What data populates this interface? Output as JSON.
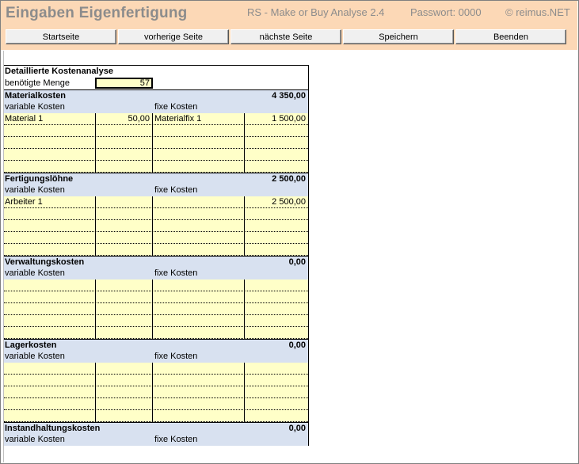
{
  "header": {
    "title": "Eingaben Eigenfertigung",
    "app_name": "RS - Make or Buy Analyse 2.4",
    "password": "Passwort: 0000",
    "copyright": "© reimus.NET"
  },
  "nav": {
    "start": "Startseite",
    "prev": "vorherige Seite",
    "next": "nächste Seite",
    "save": "Speichern",
    "quit": "Beenden"
  },
  "sheet": {
    "title": "Detaillierte Kostenanalyse",
    "qty_label": "benötigte Menge",
    "qty_value": "57",
    "var_label": "variable Kosten",
    "fix_label": "fixe Kosten",
    "sections": [
      {
        "name": "Materialkosten",
        "total": "4 350,00",
        "rows": [
          {
            "var_name": "Material 1",
            "var_value": "50,00",
            "fix_name": "Materialfix 1",
            "fix_value": "1 500,00"
          },
          {
            "var_name": "",
            "var_value": "",
            "fix_name": "",
            "fix_value": ""
          },
          {
            "var_name": "",
            "var_value": "",
            "fix_name": "",
            "fix_value": ""
          },
          {
            "var_name": "",
            "var_value": "",
            "fix_name": "",
            "fix_value": ""
          },
          {
            "var_name": "",
            "var_value": "",
            "fix_name": "",
            "fix_value": ""
          }
        ]
      },
      {
        "name": "Fertigungslöhne",
        "total": "2 500,00",
        "rows": [
          {
            "var_name": "Arbeiter 1",
            "var_value": "",
            "fix_name": "",
            "fix_value": "2 500,00"
          },
          {
            "var_name": "",
            "var_value": "",
            "fix_name": "",
            "fix_value": ""
          },
          {
            "var_name": "",
            "var_value": "",
            "fix_name": "",
            "fix_value": ""
          },
          {
            "var_name": "",
            "var_value": "",
            "fix_name": "",
            "fix_value": ""
          },
          {
            "var_name": "",
            "var_value": "",
            "fix_name": "",
            "fix_value": ""
          }
        ]
      },
      {
        "name": "Verwaltungskosten",
        "total": "0,00",
        "rows": [
          {
            "var_name": "",
            "var_value": "",
            "fix_name": "",
            "fix_value": ""
          },
          {
            "var_name": "",
            "var_value": "",
            "fix_name": "",
            "fix_value": ""
          },
          {
            "var_name": "",
            "var_value": "",
            "fix_name": "",
            "fix_value": ""
          },
          {
            "var_name": "",
            "var_value": "",
            "fix_name": "",
            "fix_value": ""
          },
          {
            "var_name": "",
            "var_value": "",
            "fix_name": "",
            "fix_value": ""
          }
        ]
      },
      {
        "name": "Lagerkosten",
        "total": "0,00",
        "rows": [
          {
            "var_name": "",
            "var_value": "",
            "fix_name": "",
            "fix_value": ""
          },
          {
            "var_name": "",
            "var_value": "",
            "fix_name": "",
            "fix_value": ""
          },
          {
            "var_name": "",
            "var_value": "",
            "fix_name": "",
            "fix_value": ""
          },
          {
            "var_name": "",
            "var_value": "",
            "fix_name": "",
            "fix_value": ""
          },
          {
            "var_name": "",
            "var_value": "",
            "fix_name": "",
            "fix_value": ""
          }
        ]
      },
      {
        "name": "Instandhaltungskosten",
        "total": "0,00",
        "rows": []
      }
    ]
  }
}
